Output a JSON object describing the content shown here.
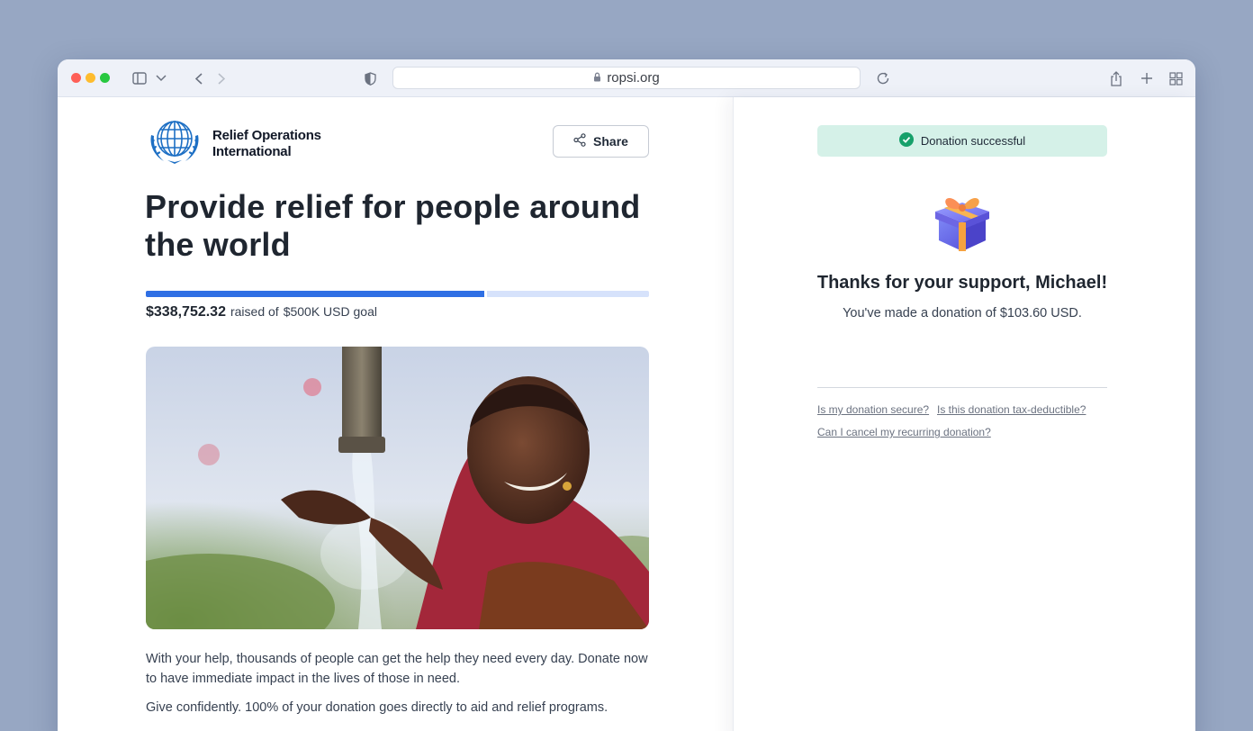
{
  "browser": {
    "url": "ropsi.org",
    "icons": [
      "sidebar-icon",
      "chevron-down-icon",
      "back-icon",
      "forward-icon",
      "shield-icon",
      "lock-icon",
      "reload-icon",
      "share-icon",
      "new-tab-icon",
      "tab-overview-icon"
    ]
  },
  "org": {
    "name_line1": "Relief Operations",
    "name_line2": "International",
    "logo_icon": "globe-wreath-icon"
  },
  "share": {
    "label": "Share",
    "icon": "share-nodes-icon"
  },
  "campaign": {
    "title": "Provide relief for people around the world",
    "raised_amount": "$338,752.32",
    "raised_suffix": "raised of",
    "goal": "$500K USD goal",
    "progress_fraction": 0.6775,
    "description": "With your help, thousands of people can get the help they need every day. Donate now to have immediate impact in the lives of those in need.",
    "description2": "Give confidently. 100% of your donation goes directly to aid and relief programs."
  },
  "confirmation": {
    "status": "Donation successful",
    "status_icon": "check-circle-icon",
    "gift_icon": "gift-icon",
    "thanks": "Thanks for your support, Michael!",
    "message": "You've made a donation of $103.60 USD.",
    "faq": [
      "Is my donation secure?",
      "Is this donation tax-deductible?",
      "Can I cancel my recurring donation?"
    ]
  },
  "colors": {
    "accent": "#2f6fe4",
    "progress_track": "#d6e2fb",
    "success_bg": "#d5f1e8",
    "success_icon": "#16a06a",
    "logo_blue": "#1d6fc4"
  }
}
